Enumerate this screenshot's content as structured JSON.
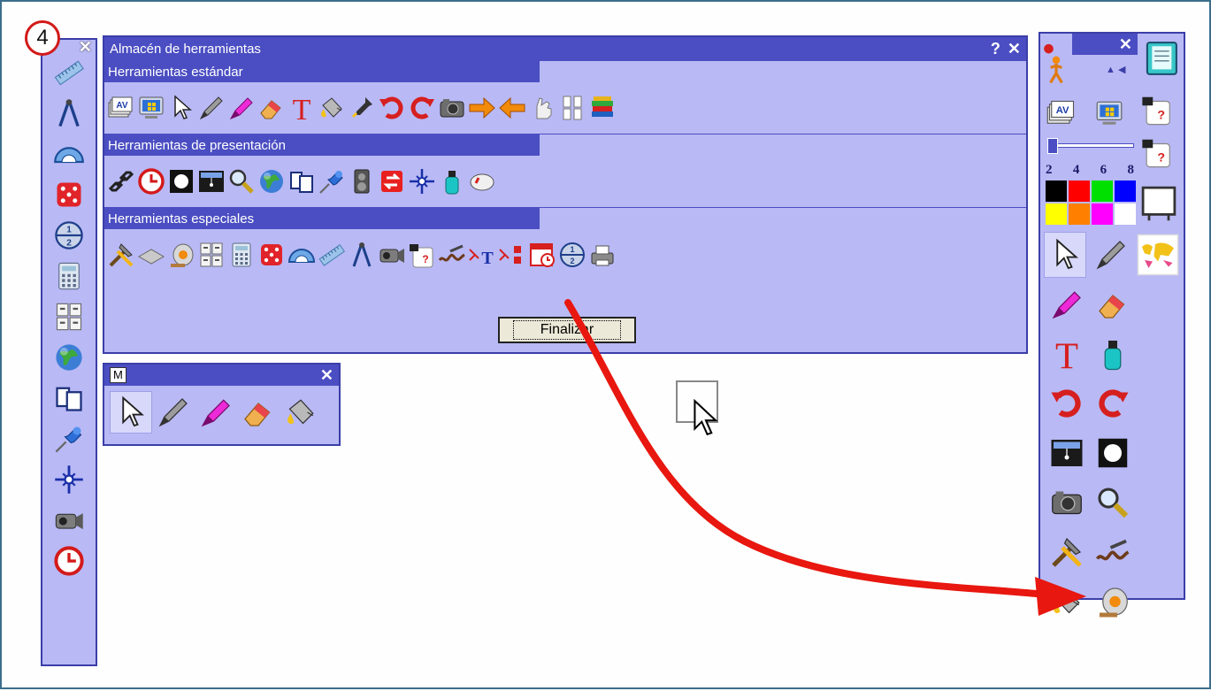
{
  "step_badge": "4",
  "store_window": {
    "title": "Almacén de herramientas",
    "help": "?",
    "close": "✕",
    "sections": [
      {
        "label": "Herramientas estándar"
      },
      {
        "label": "Herramientas de presentación"
      },
      {
        "label": "Herramientas especiales"
      }
    ],
    "finish_button": "Finalizar"
  },
  "mini_palette": {
    "label": "M",
    "close": "✕"
  },
  "left_tray": {
    "close": "✕"
  },
  "right_tray": {
    "close": "✕",
    "widths": [
      "2",
      "4",
      "6",
      "8"
    ]
  },
  "colors": {
    "palette_bg": "#b9b9f5",
    "title_bg": "#4b4ec2",
    "arrow": "#e8170f",
    "swatches": [
      "#000000",
      "#ff0000",
      "#00e000",
      "#0000ff",
      "#ffff00",
      "#ff8000",
      "#ff00ff",
      "#ffffff"
    ]
  }
}
